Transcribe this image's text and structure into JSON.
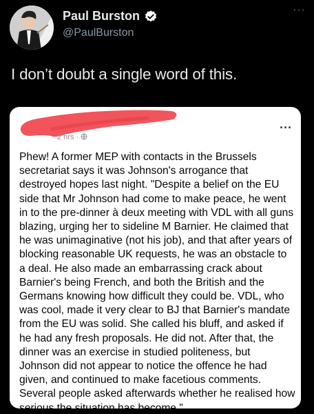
{
  "tweet": {
    "author_name": "Paul Burston",
    "handle": "@PaulBurston",
    "more_glyph": "···",
    "text": "I don’t doubt a single word of this."
  },
  "post": {
    "time_label": "2 hrs · ",
    "more_glyph": "···",
    "body_lines": [
      "Phew! A former MEP with contacts in the Brussels",
      "secretariat says it was Johnson's arrogance that",
      "destroyed hopes last night. \"Despite a belief on the EU",
      "side that Mr Johnson had come to make peace, he went",
      "in to the pre-dinner à deux meeting with VDL with all guns",
      "blazing, urging her to sideline M Barnier. He claimed that",
      "he was unimaginative (not his job), and that after years of",
      "blocking reasonable UK requests, he was an obstacle to",
      "a deal. He also made an embarrassing crack about",
      "Barnier's being French, and both the British and the",
      "Germans knowing how difficult they could be. VDL, who",
      "was cool, made it very clear to BJ that Barnier's mandate",
      "from the EU was solid. She called his bluff, and asked if",
      "he had any fresh proposals. He did not. After that, the",
      "dinner was an exercise in studied politeness, but",
      "Johnson did not appear to notice the offence he had",
      "given, and continued to make facetious comments.",
      "Several people asked afterwards whether he realised how",
      "serious the situation has become.\""
    ]
  },
  "colors": {
    "background": "#000000",
    "name": "#e7e9ea",
    "handle": "#8b98a5",
    "verified": "#ffffff",
    "card": "#ffffff",
    "redaction": "#f2545b"
  },
  "icons": [
    "avatar",
    "verified-badge-icon",
    "more-options-icon",
    "globe-icon"
  ]
}
